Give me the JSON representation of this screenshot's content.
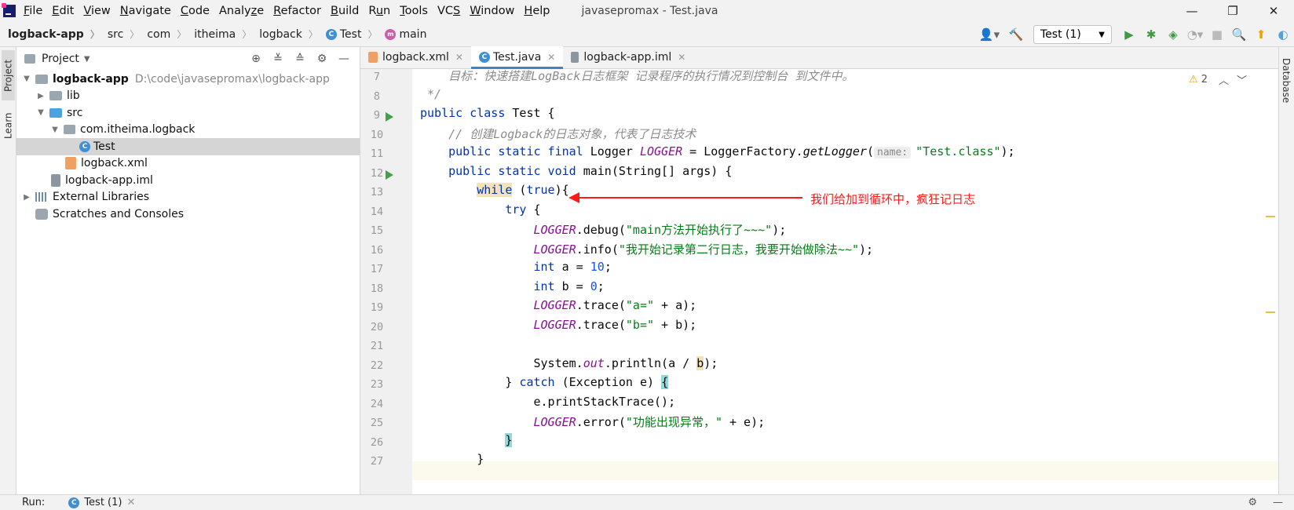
{
  "window": {
    "title": "javasepromax - Test.java",
    "controls": {
      "minimize": "—",
      "restore": "❐",
      "close": "✕"
    }
  },
  "menu": [
    {
      "pre": "",
      "u": "F",
      "post": "ile"
    },
    {
      "pre": "",
      "u": "E",
      "post": "dit"
    },
    {
      "pre": "",
      "u": "V",
      "post": "iew"
    },
    {
      "pre": "",
      "u": "N",
      "post": "avigate"
    },
    {
      "pre": "",
      "u": "C",
      "post": "ode"
    },
    {
      "pre": "Analy",
      "u": "z",
      "post": "e"
    },
    {
      "pre": "",
      "u": "R",
      "post": "efactor"
    },
    {
      "pre": "",
      "u": "B",
      "post": "uild"
    },
    {
      "pre": "R",
      "u": "u",
      "post": "n"
    },
    {
      "pre": "",
      "u": "T",
      "post": "ools"
    },
    {
      "pre": "VC",
      "u": "S",
      "post": ""
    },
    {
      "pre": "",
      "u": "W",
      "post": "indow"
    },
    {
      "pre": "",
      "u": "H",
      "post": "elp"
    }
  ],
  "breadcrumbs": [
    "logback-app",
    "src",
    "com",
    "itheima",
    "logback",
    "Test",
    "main"
  ],
  "toolbar": {
    "run_config": "Test (1)",
    "icons": [
      "user-icon",
      "build-icon",
      "run-icon",
      "debug-icon",
      "coverage-icon",
      "profile-icon",
      "stop-icon",
      "search-icon",
      "update-icon",
      "plugin-icon"
    ]
  },
  "left_stripe": {
    "project": "Project",
    "learn": "Learn"
  },
  "right_stripe": {
    "database": "Database"
  },
  "project_panel": {
    "title": "Project",
    "root": {
      "name": "logback-app",
      "path": "D:\\code\\javasepromax\\logback-app"
    },
    "items": [
      {
        "name": "lib"
      },
      {
        "name": "src"
      },
      {
        "name": "com.itheima.logback"
      },
      {
        "name": "Test"
      },
      {
        "name": "logback.xml"
      },
      {
        "name": "logback-app.iml"
      },
      {
        "name": "External Libraries"
      },
      {
        "name": "Scratches and Consoles"
      }
    ]
  },
  "editor": {
    "tabs": [
      {
        "label": "logback.xml",
        "active": false
      },
      {
        "label": "Test.java",
        "active": true
      },
      {
        "label": "logback-app.iml",
        "active": false
      }
    ],
    "warnings": "2",
    "line_numbers": [
      7,
      8,
      9,
      10,
      11,
      12,
      13,
      14,
      15,
      16,
      17,
      18,
      19,
      20,
      21,
      22,
      23,
      24,
      25,
      26,
      27
    ],
    "code": {
      "l7": "    目标：快速搭建LogBack日志框架 记录程序的执行情况到控制台 到文件中。",
      "l8": " */",
      "l9_kw": "public class ",
      "l9_rest": "Test {",
      "l10": "    // 创建Logback的日志对象，代表了日志技术",
      "l11_kw": "    public static final ",
      "l11_a": "Logger ",
      "l11_static": "LOGGER",
      "l11_b": " = LoggerFactory.",
      "l11_m": "getLogger",
      "l11_c": "(",
      "l11_hint": "name:",
      "l11_str": "\"Test.class\"",
      "l11_d": ");",
      "l12_kw": "    public static void ",
      "l12_rest": "main(String[] args) {",
      "l13_indent": "        ",
      "l13_kw": "while",
      "l13_a": " (",
      "l13_kw2": "true",
      "l13_b": "){",
      "l14_indent": "            ",
      "l14_kw": "try",
      "l14_rest": " {",
      "l15_indent": "                ",
      "l15_static": "LOGGER",
      "l15_a": ".debug(",
      "l15_str": "\"main方法开始执行了~~~\"",
      "l15_b": ");",
      "l16_indent": "                ",
      "l16_static": "LOGGER",
      "l16_a": ".info(",
      "l16_str": "\"我开始记录第二行日志，我要开始做除法~~\"",
      "l16_b": ");",
      "l17_indent": "                ",
      "l17_kw": "int",
      "l17_a": " a = ",
      "l17_num": "10",
      "l17_b": ";",
      "l18_indent": "                ",
      "l18_kw": "int",
      "l18_a": " b = ",
      "l18_num": "0",
      "l18_b": ";",
      "l19_indent": "                ",
      "l19_static": "LOGGER",
      "l19_a": ".trace(",
      "l19_str": "\"a=\"",
      "l19_b": " + a);",
      "l20_indent": "                ",
      "l20_static": "LOGGER",
      "l20_a": ".trace(",
      "l20_str": "\"b=\"",
      "l20_b": " + b);",
      "l22_indent": "                ",
      "l22_a": "System.",
      "l22_static": "out",
      "l22_b": ".println(a / ",
      "l22_hl": "b",
      "l22_c": ");",
      "l23_indent": "            ",
      "l23_a": "} ",
      "l23_kw": "catch",
      "l23_b": " (Exception e) ",
      "l23_brace": "{",
      "l24": "                e.printStackTrace();",
      "l25_indent": "                ",
      "l25_static": "LOGGER",
      "l25_a": ".error(",
      "l25_str": "\"功能出现异常，\"",
      "l25_b": " + e);",
      "l26_indent": "            ",
      "l26_brace": "}",
      "l27": "        }"
    },
    "annotation": "我们给加到循环中，疯狂记日志"
  },
  "bottom": {
    "run_label": "Run:",
    "run_tab": "Test (1)"
  }
}
